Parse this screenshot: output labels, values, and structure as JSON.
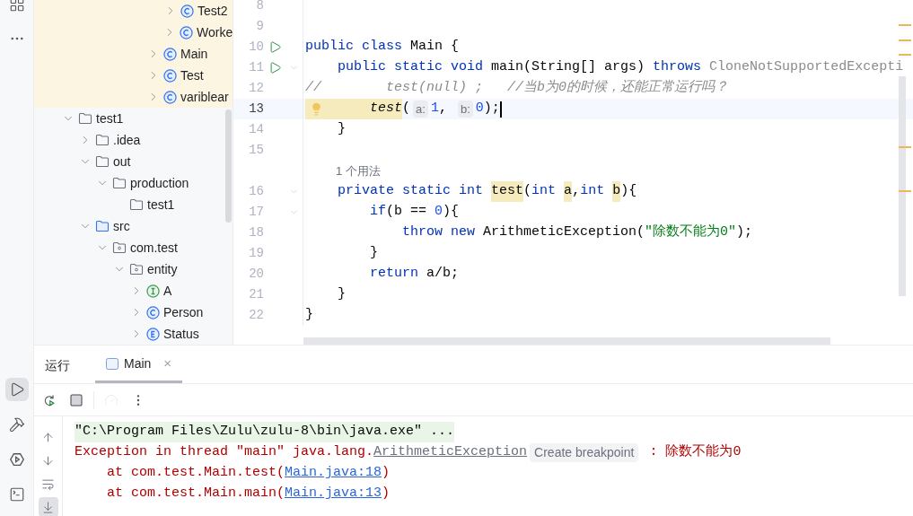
{
  "left_strip": {
    "top": [
      {
        "kind": "structure",
        "selected": false
      },
      {
        "kind": "more",
        "selected": false
      }
    ],
    "bottom": [
      {
        "kind": "run",
        "selected": true
      },
      {
        "kind": "build",
        "selected": false
      },
      {
        "kind": "services",
        "selected": false
      },
      {
        "kind": "terminal",
        "selected": false
      }
    ]
  },
  "project_tree": {
    "items": [
      {
        "children": [
          {
            "children": [
              {
                "children": [
                  {
                    "children": [
                      {
                        "children": [
                          {
                            "children": [
                              {
                                "label": "Test2",
                                "kind": "class",
                                "expanded": false,
                                "highlighted": true
                              },
                              {
                                "label": "Worke",
                                "kind": "class",
                                "expanded": false,
                                "highlighted": true
                              }
                            ]
                          },
                          {
                            "label": "Main",
                            "kind": "class",
                            "expanded": false,
                            "highlighted": true
                          },
                          {
                            "label": "Test",
                            "kind": "class",
                            "expanded": false,
                            "highlighted": true
                          },
                          {
                            "label": "variblear",
                            "kind": "class",
                            "expanded": false,
                            "highlighted": true
                          }
                        ]
                      }
                    ]
                  }
                ]
              }
            ]
          }
        ]
      },
      {
        "label": "test1",
        "kind": "folder",
        "expanded": true,
        "highlighted": false,
        "children": [
          {
            "label": ".idea",
            "kind": "folder",
            "expanded": false,
            "highlighted": false
          },
          {
            "label": "out",
            "kind": "folder",
            "expanded": true,
            "highlighted": false,
            "children": [
              {
                "label": "production",
                "kind": "folder",
                "expanded": true,
                "highlighted": false,
                "children": [
                  {
                    "label": "test1",
                    "kind": "folder",
                    "highlighted": false
                  }
                ]
              }
            ]
          },
          {
            "label": "src",
            "kind": "source",
            "expanded": true,
            "highlighted": false,
            "children": [
              {
                "label": "com.test",
                "kind": "package",
                "expanded": true,
                "highlighted": false,
                "children": [
                  {
                    "label": "entity",
                    "kind": "package",
                    "expanded": true,
                    "highlighted": false,
                    "children": [
                      {
                        "label": "A",
                        "kind": "interface",
                        "expanded": false,
                        "highlighted": false
                      },
                      {
                        "label": "Person",
                        "kind": "class",
                        "expanded": false,
                        "highlighted": false
                      },
                      {
                        "label": "Status",
                        "kind": "enum",
                        "expanded": false,
                        "highlighted": false
                      }
                    ]
                  }
                ]
              }
            ]
          }
        ]
      }
    ]
  },
  "editor": {
    "lines": [
      {
        "number": "8",
        "run": false,
        "fold": false,
        "current": false
      },
      {
        "number": "9",
        "run": false,
        "fold": false,
        "current": false
      },
      {
        "number": "10",
        "run": true,
        "fold": false,
        "current": false,
        "segments": [
          {
            "kind": "kw",
            "text": "public "
          },
          {
            "kind": "kw",
            "text": "class "
          },
          {
            "kind": "plain",
            "text": "Main {"
          }
        ]
      },
      {
        "number": "11",
        "run": true,
        "fold": true,
        "current": false,
        "segments": [
          {
            "kind": "kw",
            "text": "    public "
          },
          {
            "kind": "kw",
            "text": "static "
          },
          {
            "kind": "kw",
            "text": "void "
          },
          {
            "kind": "plain",
            "text": "main(String[] args) "
          },
          {
            "kind": "kw",
            "text": "throws "
          },
          {
            "kind": "unused",
            "text": "CloneNotSupportedExcepti"
          }
        ]
      },
      {
        "number": "12",
        "run": false,
        "fold": false,
        "current": false,
        "segments": [
          {
            "kind": "comment",
            "text": "//        test(null) ;   //当b为0的时候，还能正常运行吗？"
          }
        ]
      },
      {
        "number": "13",
        "run": false,
        "fold": false,
        "current": true,
        "bulb": true,
        "segments": [
          {
            "kind": "call",
            "text": "        test"
          },
          {
            "kind": "plain",
            "text": "("
          },
          {
            "kind": "hint",
            "text": "a:"
          },
          {
            "kind": "num",
            "text": "1"
          },
          {
            "kind": "plain",
            "text": ", "
          },
          {
            "kind": "hint",
            "text": "b:"
          },
          {
            "kind": "num",
            "text": "0"
          },
          {
            "kind": "plain",
            "text": ");"
          }
        ]
      },
      {
        "number": "14",
        "run": false,
        "fold": false,
        "current": false,
        "segments": [
          {
            "kind": "plain",
            "text": "    }"
          }
        ]
      },
      {
        "number": "15",
        "run": false,
        "fold": false,
        "current": false
      },
      {
        "kind": "usages",
        "text": "1 个用法"
      },
      {
        "number": "16",
        "run": false,
        "fold": true,
        "current": false,
        "segments": [
          {
            "kind": "kw",
            "text": "    private "
          },
          {
            "kind": "kw",
            "text": "static "
          },
          {
            "kind": "kw",
            "text": "int "
          },
          {
            "kind": "mark",
            "text": "test"
          },
          {
            "kind": "plain",
            "text": "("
          },
          {
            "kind": "kw",
            "text": "int "
          },
          {
            "kind": "mark",
            "text": "a"
          },
          {
            "kind": "plain",
            "text": ","
          },
          {
            "kind": "kw",
            "text": "int "
          },
          {
            "kind": "mark",
            "text": "b"
          },
          {
            "kind": "plain",
            "text": "){"
          }
        ]
      },
      {
        "number": "17",
        "run": false,
        "fold": true,
        "current": false,
        "segments": [
          {
            "kind": "kw",
            "text": "        if"
          },
          {
            "kind": "plain",
            "text": "(b == "
          },
          {
            "kind": "num",
            "text": "0"
          },
          {
            "kind": "plain",
            "text": "){"
          }
        ]
      },
      {
        "number": "18",
        "run": false,
        "fold": false,
        "current": false,
        "segments": [
          {
            "kind": "kw",
            "text": "            throw "
          },
          {
            "kind": "kw",
            "text": "new "
          },
          {
            "kind": "plain",
            "text": "ArithmeticException("
          },
          {
            "kind": "str",
            "text": "\"除数不能为0\""
          },
          {
            "kind": "plain",
            "text": ");"
          }
        ]
      },
      {
        "number": "19",
        "run": false,
        "fold": false,
        "current": false,
        "segments": [
          {
            "kind": "plain",
            "text": "        }"
          }
        ]
      },
      {
        "number": "20",
        "run": false,
        "fold": false,
        "current": false,
        "segments": [
          {
            "kind": "kw",
            "text": "        return "
          },
          {
            "kind": "plain",
            "text": "a/b;"
          }
        ]
      },
      {
        "number": "21",
        "run": false,
        "fold": false,
        "current": false,
        "segments": [
          {
            "kind": "plain",
            "text": "    }"
          }
        ]
      },
      {
        "number": "22",
        "run": false,
        "fold": false,
        "current": false,
        "segments": [
          {
            "kind": "plain",
            "text": "}"
          }
        ]
      }
    ]
  },
  "run_panel": {
    "title": "运行",
    "tabs": [
      {
        "label": "Main",
        "selected": true,
        "close": "×"
      }
    ],
    "toolbar": [
      {
        "kind": "rerun",
        "disabled": false
      },
      {
        "kind": "stop",
        "disabled": false
      },
      {
        "kind": "profiler",
        "disabled": true
      },
      {
        "kind": "more",
        "disabled": false
      }
    ],
    "side": [
      {
        "kind": "up",
        "selected": false
      },
      {
        "kind": "down",
        "selected": false
      },
      {
        "kind": "wrap",
        "selected": false
      },
      {
        "kind": "scroll-end",
        "selected": true
      }
    ],
    "console": [
      [
        {
          "kind": "cmd",
          "text": "\"C:\\Program Files\\Zulu\\zulu-8\\bin\\java.exe\" ..."
        }
      ],
      [
        {
          "kind": "err",
          "text": "Exception in thread \"main\" java.lang."
        },
        {
          "kind": "glink",
          "text": "ArithmeticException"
        },
        {
          "kind": "badge",
          "text": "Create breakpoint"
        },
        {
          "kind": "err",
          "text": " : 除数不能为0"
        }
      ],
      [
        {
          "kind": "err",
          "text": "    at com.test.Main.test("
        },
        {
          "kind": "link",
          "text": "Main.java:18"
        },
        {
          "kind": "err",
          "text": ")"
        }
      ],
      [
        {
          "kind": "err",
          "text": "    at com.test.Main.main("
        },
        {
          "kind": "link",
          "text": "Main.java:13"
        },
        {
          "kind": "err",
          "text": ")"
        }
      ]
    ]
  }
}
